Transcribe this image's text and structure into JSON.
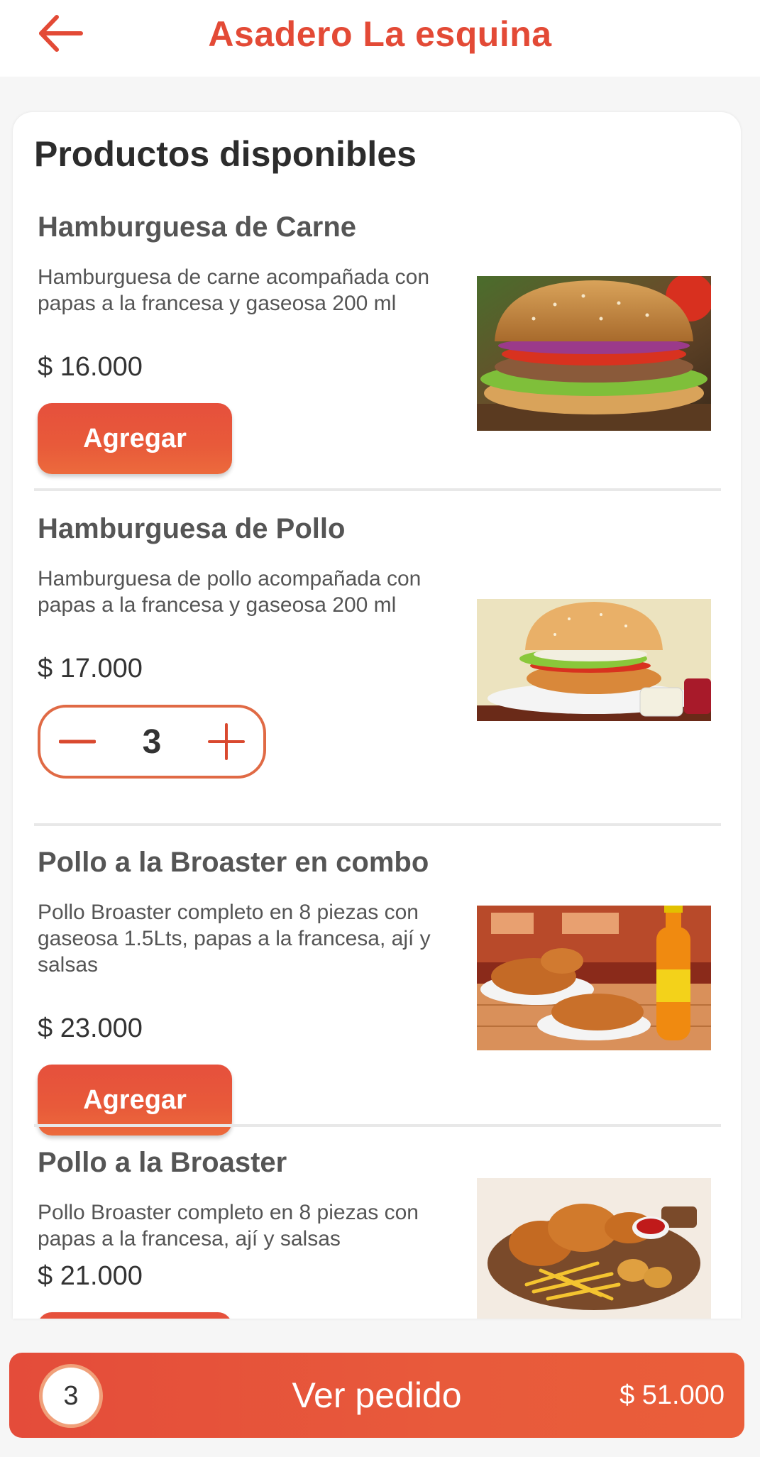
{
  "header": {
    "title": "Asadero La esquina",
    "back_icon": "arrow-left-icon",
    "accent": "#e34a36"
  },
  "main": {
    "section_title": "Productos disponibles",
    "add_label": "Agregar",
    "products": [
      {
        "name": "Hamburguesa de Carne",
        "description": "Hamburguesa de carne acompañada con papas a la francesa y gaseosa 200 ml",
        "price": "$ 16.000",
        "image": "beef-burger-photo"
      },
      {
        "name": "Hamburguesa de Pollo",
        "description": "Hamburguesa de pollo acompañada con papas a la francesa y gaseosa 200 ml",
        "price": "$ 17.000",
        "image": "chicken-burger-photo",
        "quantity": "3"
      },
      {
        "name": "Pollo a la Broaster en combo",
        "description": "Pollo Broaster completo en 8 piezas con gaseosa 1.5Lts, papas a la francesa, ají y salsas",
        "price": "$ 23.000",
        "image": "broaster-combo-photo"
      },
      {
        "name": "Pollo a la Broaster",
        "description": "Pollo Broaster completo en 8 piezas con papas a la francesa, ají y salsas",
        "price": "$ 21.000",
        "image": "broaster-platter-photo"
      }
    ]
  },
  "cart": {
    "count": "3",
    "label": "Ver pedido",
    "total": "$ 51.000"
  }
}
